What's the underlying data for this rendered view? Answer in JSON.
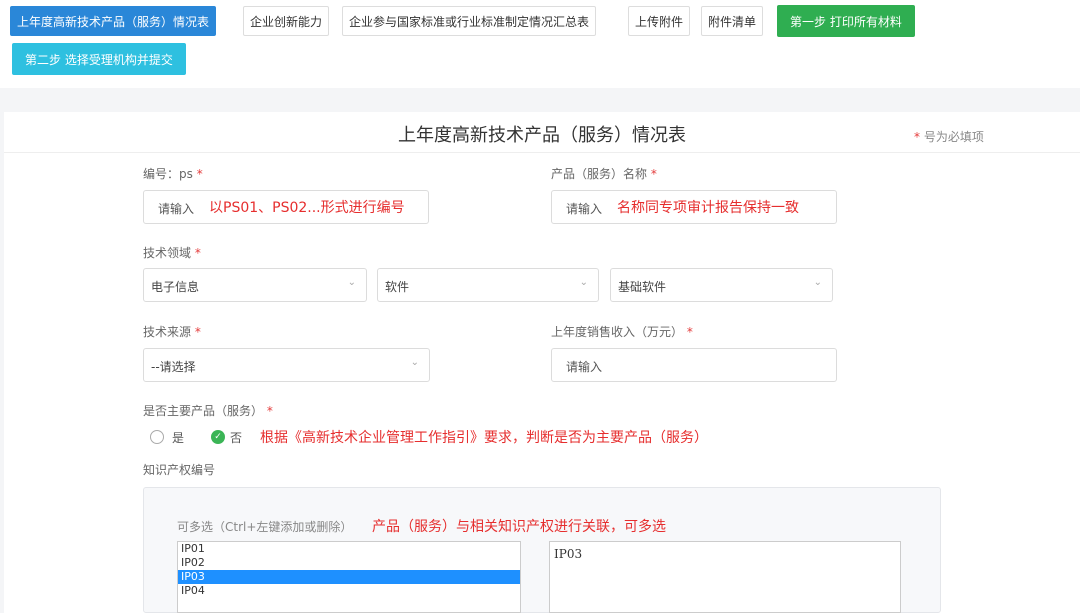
{
  "tabs": [
    {
      "label": "上年度高新技术产品（服务）情况表"
    },
    {
      "label": "企业创新能力"
    },
    {
      "label": "企业参与国家标准或行业标准制定情况汇总表"
    },
    {
      "label": "上传附件"
    },
    {
      "label": "附件清单"
    },
    {
      "label": "第一步 打印所有材料"
    },
    {
      "label": "第二步 选择受理机构并提交"
    }
  ],
  "form": {
    "title": "上年度高新技术产品（服务）情况表",
    "required_note": "号为必填项",
    "star": "*"
  },
  "fields": {
    "code": {
      "label": "编号：ps",
      "placeholder": "请输入",
      "hint": "以PS01、PS02...形式进行编号"
    },
    "name": {
      "label": "产品（服务）名称",
      "placeholder": "请输入",
      "hint": "名称同专项审计报告保持一致"
    },
    "tech_field": {
      "label": "技术领域",
      "selects": [
        "电子信息",
        "软件",
        "基础软件"
      ]
    },
    "tech_source": {
      "label": "技术来源",
      "value": "--请选择"
    },
    "revenue": {
      "label": "上年度销售收入（万元）",
      "placeholder": "请输入"
    },
    "main_product": {
      "label": "是否主要产品（服务）",
      "yes": "是",
      "no": "否",
      "selected": "否",
      "hint": "根据《高新技术企业管理工作指引》要求，判断是否为主要产品（服务）"
    },
    "ip": {
      "label": "知识产权编号",
      "help": "可多选（Ctrl+左键添加或删除）",
      "hint": "产品（服务）与相关知识产权进行关联，可多选",
      "options": [
        "IP01",
        "IP02",
        "IP03",
        "IP04"
      ],
      "selected_option": "IP03",
      "selected_display": "IP03"
    }
  },
  "colors": {
    "primary": "#2a87d8",
    "green": "#2fae51",
    "cyan": "#2ec0e0",
    "required": "#e43b3b",
    "hint": "#e62e2e"
  }
}
